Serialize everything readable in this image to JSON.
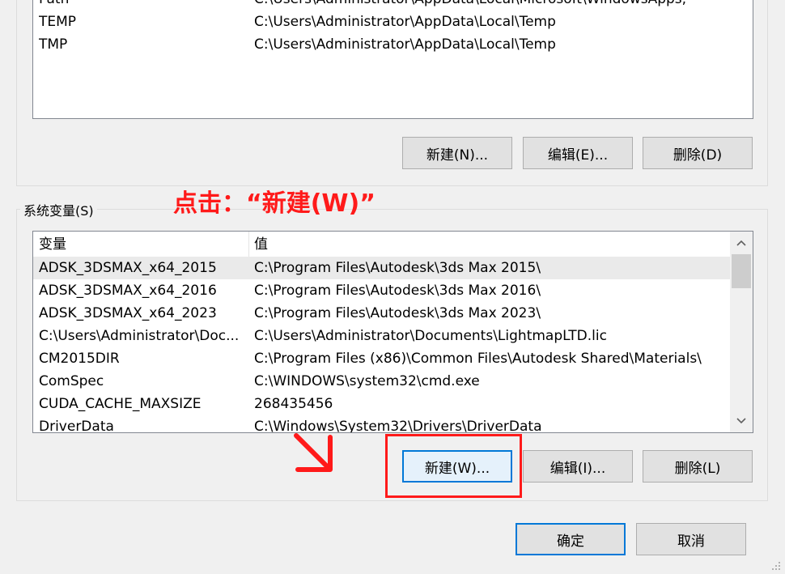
{
  "user_vars": {
    "rows": [
      {
        "name": "Path",
        "value": "C:\\Users\\Administrator\\AppData\\Local\\Microsoft\\WindowsApps;"
      },
      {
        "name": "TEMP",
        "value": "C:\\Users\\Administrator\\AppData\\Local\\Temp"
      },
      {
        "name": "TMP",
        "value": "C:\\Users\\Administrator\\AppData\\Local\\Temp"
      }
    ],
    "buttons": {
      "new": "新建(N)...",
      "edit": "编辑(E)...",
      "delete": "删除(D)"
    }
  },
  "sys_vars": {
    "title": "系统变量(S)",
    "columns": {
      "name": "变量",
      "value": "值"
    },
    "rows": [
      {
        "name": "ADSK_3DSMAX_x64_2015",
        "value": "C:\\Program Files\\Autodesk\\3ds Max 2015\\"
      },
      {
        "name": "ADSK_3DSMAX_x64_2016",
        "value": "C:\\Program Files\\Autodesk\\3ds Max 2016\\"
      },
      {
        "name": "ADSK_3DSMAX_x64_2023",
        "value": "C:\\Program Files\\Autodesk\\3ds Max 2023\\"
      },
      {
        "name": "C:\\Users\\Administrator\\Doc...",
        "value": "C:\\Users\\Administrator\\Documents\\LightmapLTD.lic"
      },
      {
        "name": "CM2015DIR",
        "value": "C:\\Program Files (x86)\\Common Files\\Autodesk Shared\\Materials\\"
      },
      {
        "name": "ComSpec",
        "value": "C:\\WINDOWS\\system32\\cmd.exe"
      },
      {
        "name": "CUDA_CACHE_MAXSIZE",
        "value": "268435456"
      },
      {
        "name": "DriverData",
        "value": "C:\\Windows\\System32\\Drivers\\DriverData"
      }
    ],
    "buttons": {
      "new": "新建(W)...",
      "edit": "编辑(I)...",
      "delete": "删除(L)"
    }
  },
  "dialog_buttons": {
    "ok": "确定",
    "cancel": "取消"
  },
  "annotation": {
    "text": "点击：“新建(W)”",
    "color": "#ff1a1a"
  }
}
